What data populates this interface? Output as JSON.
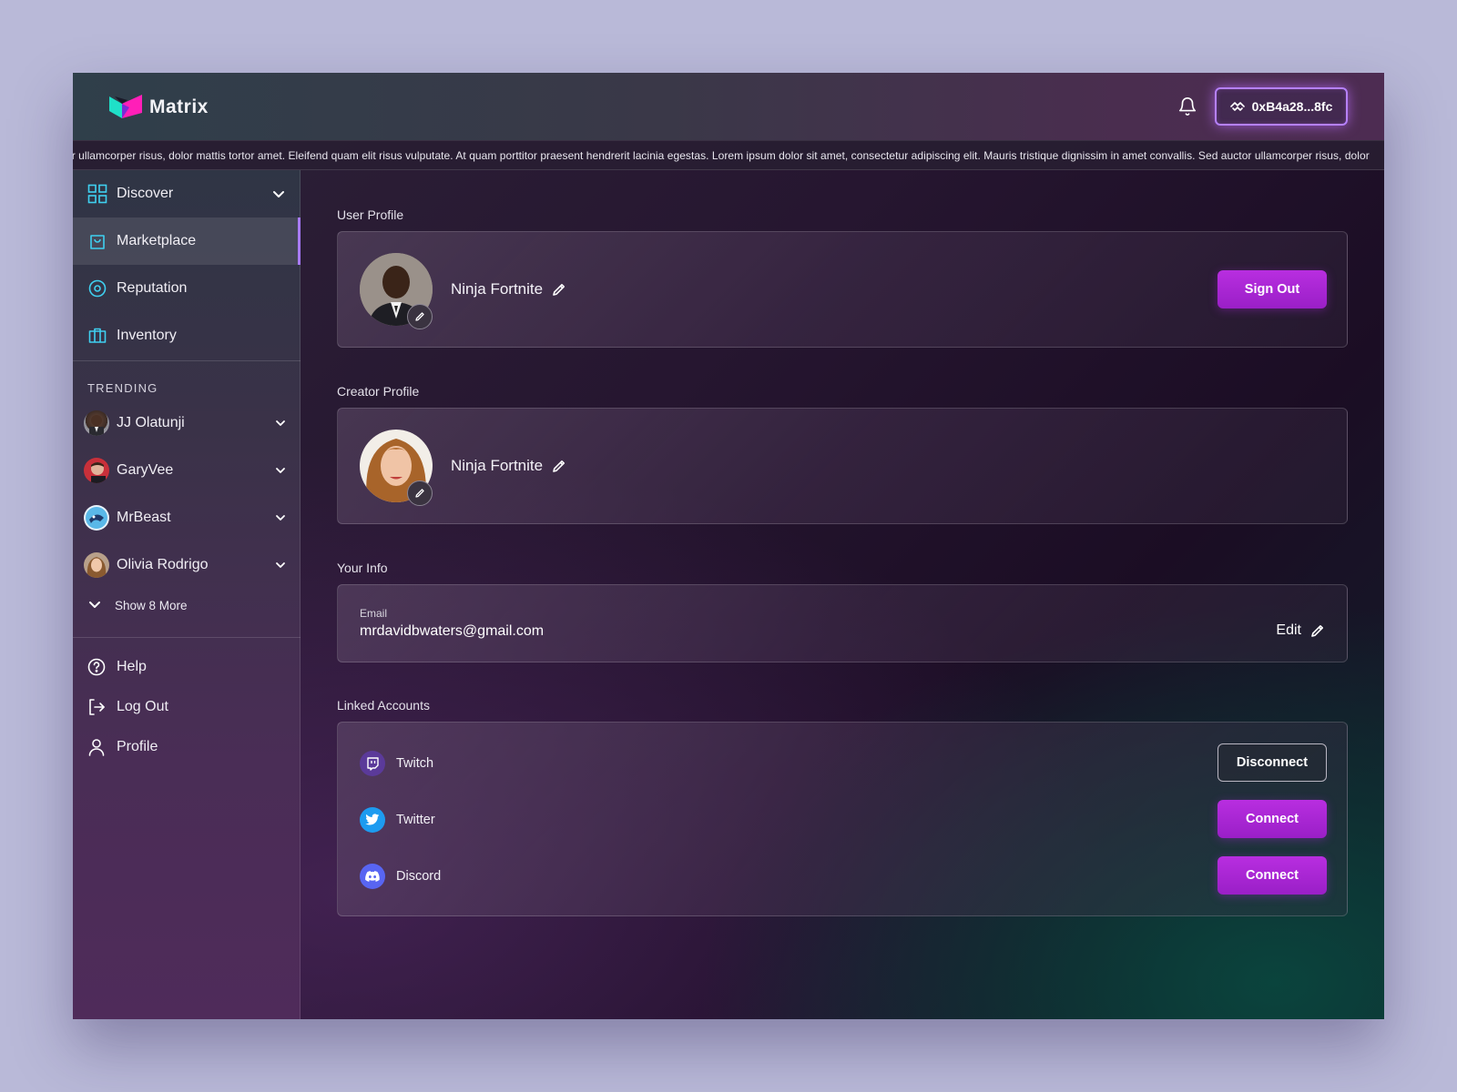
{
  "app": {
    "name": "Matrix",
    "wallet_address": "0xB4a28...8fc",
    "ticker": "or ullamcorper risus, dolor mattis tortor amet. Eleifend quam elit risus vulputate. At quam porttitor praesent hendrerit lacinia egestas. Lorem ipsum dolor sit amet, consectetur adipiscing elit. Mauris tristique dignissim in amet convallis. Sed auctor ullamcorper risus, dolor"
  },
  "sidebar": {
    "nav": [
      {
        "label": "Discover",
        "icon": "grid-icon"
      },
      {
        "label": "Marketplace",
        "icon": "shopping-bag-icon"
      },
      {
        "label": "Reputation",
        "icon": "target-icon"
      },
      {
        "label": "Inventory",
        "icon": "briefcase-icon"
      }
    ],
    "trending_label": "TRENDING",
    "trending": [
      {
        "label": "JJ Olatunji"
      },
      {
        "label": "GaryVee"
      },
      {
        "label": "MrBeast"
      },
      {
        "label": "Olivia Rodrigo"
      }
    ],
    "show_more": "Show 8 More",
    "bottom": [
      {
        "label": "Help",
        "icon": "help-circle-icon"
      },
      {
        "label": "Log Out",
        "icon": "logout-icon"
      },
      {
        "label": "Profile",
        "icon": "user-icon"
      }
    ]
  },
  "main": {
    "user_profile": {
      "title": "User Profile",
      "name": "Ninja Fortnite",
      "sign_out": "Sign Out"
    },
    "creator_profile": {
      "title": "Creator Profile",
      "name": "Ninja Fortnite"
    },
    "your_info": {
      "title": "Your Info",
      "email_label": "Email",
      "email_value": "mrdavidbwaters@gmail.com",
      "edit": "Edit"
    },
    "linked_accounts": {
      "title": "Linked Accounts",
      "accounts": [
        {
          "name": "Twitch",
          "action": "Disconnect",
          "color": "#6441a5"
        },
        {
          "name": "Twitter",
          "action": "Connect",
          "color": "#1d9bf0"
        },
        {
          "name": "Discord",
          "action": "Connect",
          "color": "#5865f2"
        }
      ]
    }
  },
  "colors": {
    "accent": "#b82ee0",
    "wallet_border": "#b681ff",
    "sidebar_icon": "#3fd0f0"
  }
}
